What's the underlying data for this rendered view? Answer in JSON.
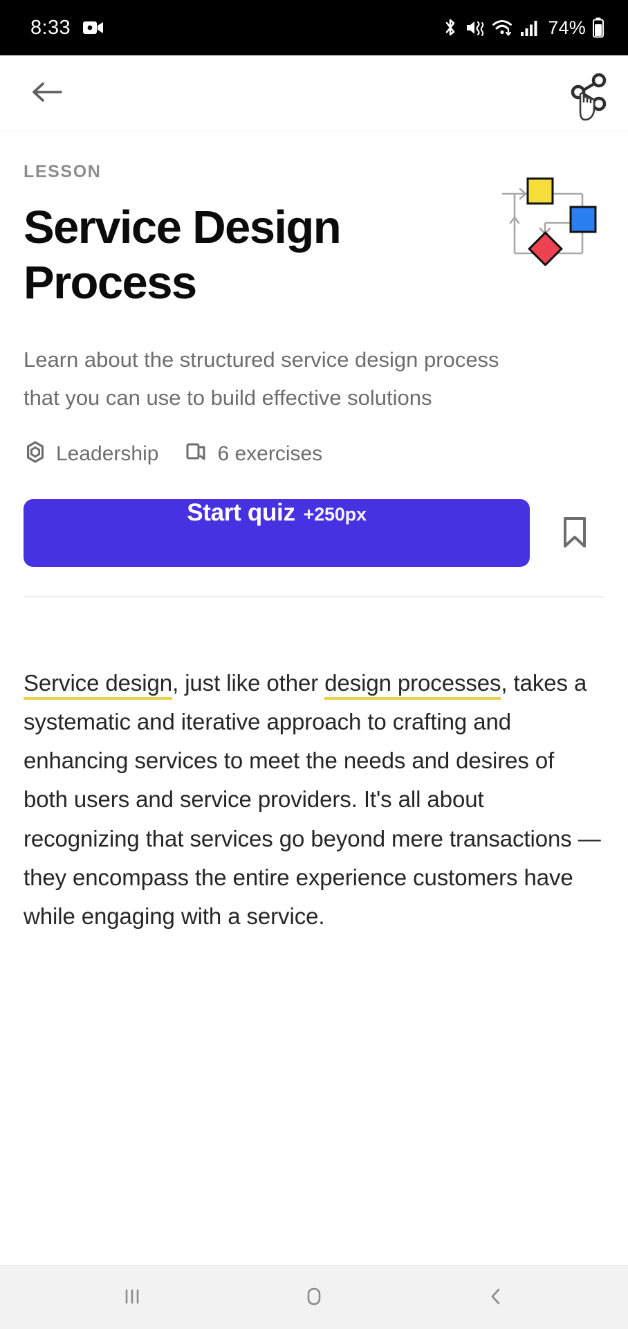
{
  "status_bar": {
    "time": "8:33",
    "battery_percent": "74%",
    "icons": [
      "video-recording-icon",
      "bluetooth-icon",
      "mute-vibrate-icon",
      "wifi-icon",
      "cellular-signal-icon",
      "battery-icon"
    ]
  },
  "header": {
    "back_icon": "back-arrow-icon",
    "share_icon": "share-icon",
    "cursor_icon": "hand-cursor-icon"
  },
  "lesson": {
    "eyebrow": "LESSON",
    "title": "Service Design Process",
    "description": "Learn about the structured service design process that you can use to build effective solutions",
    "meta": [
      {
        "icon": "hexagon-gear-icon",
        "label": "Leadership"
      },
      {
        "icon": "cards-stack-icon",
        "label": "6 exercises"
      }
    ],
    "cta": {
      "label": "Start quiz",
      "points": "+250px"
    },
    "bookmark_icon": "bookmark-icon",
    "graphic": {
      "name": "flowchart-graphic",
      "shapes": [
        "yellow-square",
        "blue-square",
        "red-diamond"
      ],
      "colors": {
        "yellow": "#f5de3c",
        "blue": "#2a7ff0",
        "red": "#ec4252",
        "line": "#a8a8a8",
        "stroke": "#111111"
      }
    }
  },
  "article": {
    "link_1": "Service design",
    "text_1": ", just like other ",
    "link_2": "design processes",
    "text_2": ", takes a systematic and iterative approach to crafting and enhancing services to meet the needs and desires of both users and service providers. It's all about recognizing that services go beyond mere transactions — they encompass the entire experience customers have while engaging with a service."
  },
  "nav_bar": {
    "recents_icon": "recents-icon",
    "home_icon": "home-icon",
    "back_icon": "nav-back-icon"
  },
  "colors": {
    "accent": "#4632e0",
    "highlight": "#e8d24a",
    "muted_text": "#6d6d6d",
    "body_text": "#262626"
  }
}
